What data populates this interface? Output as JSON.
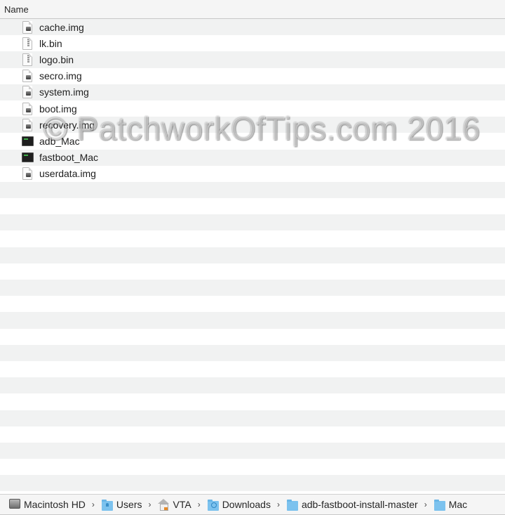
{
  "header": {
    "column_name": "Name"
  },
  "files": [
    {
      "name": "cache.img",
      "icon": "disk-image-icon"
    },
    {
      "name": "lk.bin",
      "icon": "archive-document-icon"
    },
    {
      "name": "logo.bin",
      "icon": "archive-document-icon"
    },
    {
      "name": "secro.img",
      "icon": "disk-image-icon"
    },
    {
      "name": "system.img",
      "icon": "disk-image-icon"
    },
    {
      "name": "boot.img",
      "icon": "disk-image-icon"
    },
    {
      "name": "recovery.img",
      "icon": "disk-image-icon"
    },
    {
      "name": "adb_Mac",
      "icon": "terminal-executable-icon"
    },
    {
      "name": "fastboot_Mac",
      "icon": "terminal-executable-icon"
    },
    {
      "name": "userdata.img",
      "icon": "disk-image-icon"
    }
  ],
  "watermark": "© PatchworkOfTips.com 2016",
  "path_bar": {
    "separator": "›",
    "items": [
      {
        "label": "Macintosh HD",
        "icon": "hard-drive-icon"
      },
      {
        "label": "Users",
        "icon": "users-folder-icon"
      },
      {
        "label": "VTA",
        "icon": "home-icon"
      },
      {
        "label": "Downloads",
        "icon": "downloads-folder-icon"
      },
      {
        "label": "adb-fastboot-install-master",
        "icon": "folder-icon"
      },
      {
        "label": "Mac",
        "icon": "folder-icon"
      }
    ]
  }
}
